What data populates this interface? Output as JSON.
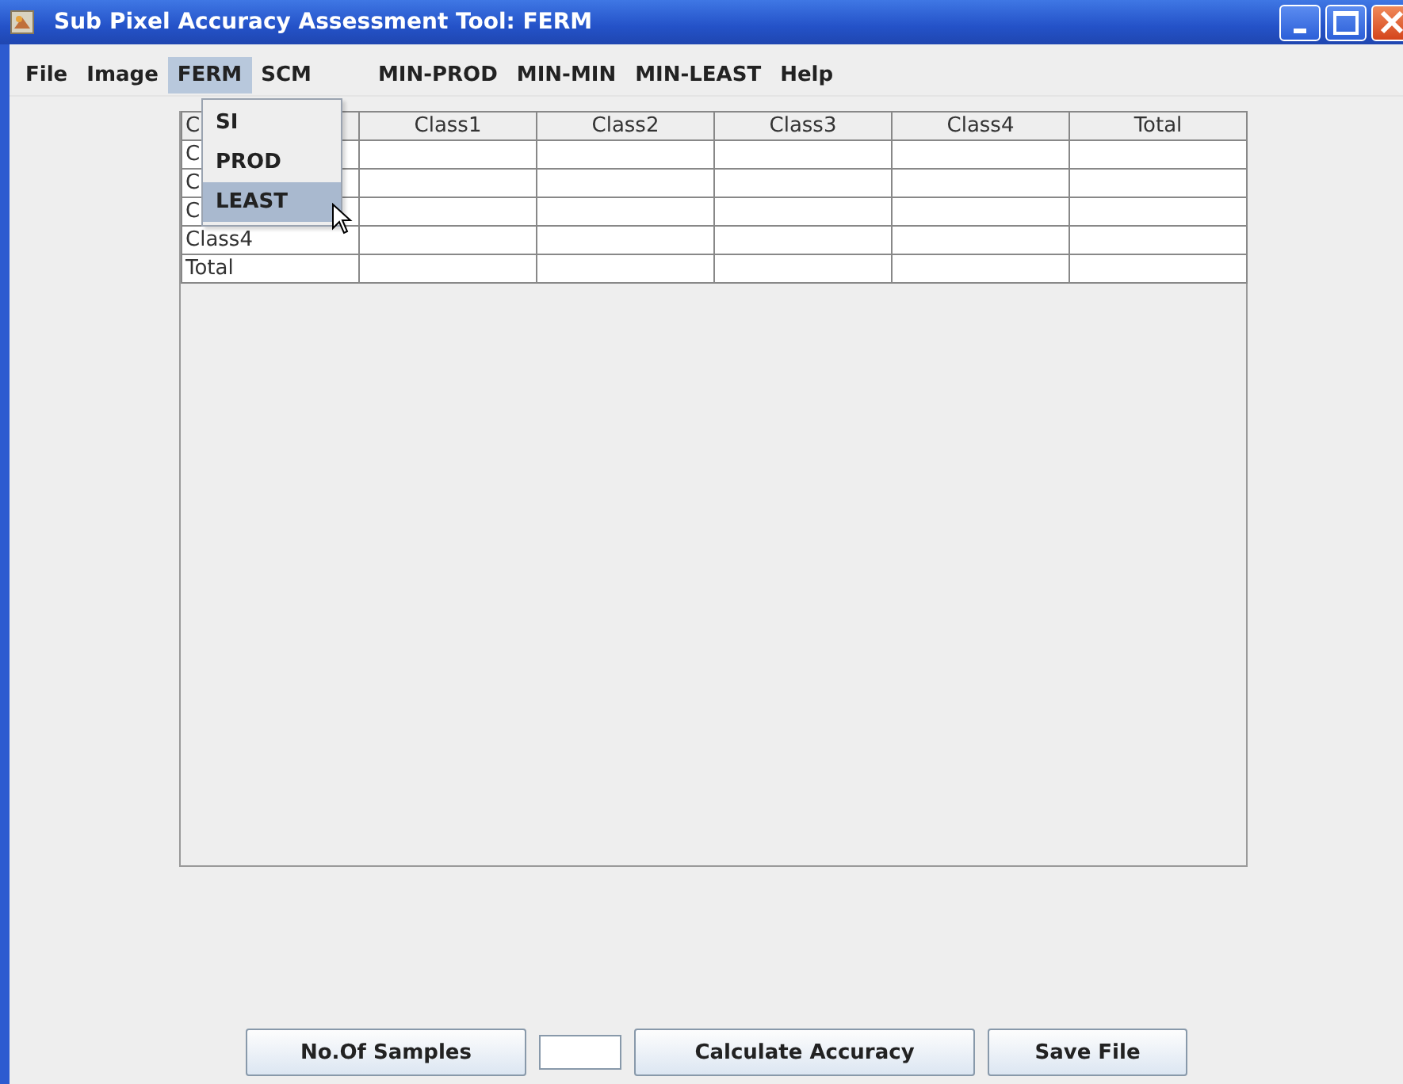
{
  "window": {
    "title": "Sub Pixel Accuracy Assessment Tool: FERM"
  },
  "menu_bar": [
    {
      "label": "File",
      "selected": false
    },
    {
      "label": "Image",
      "selected": false
    },
    {
      "label": "FERM",
      "selected": true
    },
    {
      "label": "SCM",
      "selected": false
    },
    {
      "label": "MIN-PROD",
      "selected": false
    },
    {
      "label": "MIN-MIN",
      "selected": false
    },
    {
      "label": "MIN-LEAST",
      "selected": false
    },
    {
      "label": "Help",
      "selected": false
    }
  ],
  "open_menu": {
    "items": [
      {
        "label": "SI",
        "selected": false
      },
      {
        "label": "PROD",
        "selected": false
      },
      {
        "label": "LEAST",
        "selected": true
      }
    ]
  },
  "table": {
    "columns": [
      "C",
      "Class1",
      "Class2",
      "Class3",
      "Class4",
      "Total"
    ],
    "rows": [
      [
        "C",
        null,
        null,
        null,
        null,
        null
      ],
      [
        "C",
        null,
        null,
        null,
        null,
        null
      ],
      [
        "C",
        null,
        null,
        null,
        null,
        null
      ],
      [
        "Class4",
        null,
        null,
        null,
        null,
        null
      ],
      [
        "Total",
        null,
        null,
        null,
        null,
        null
      ]
    ]
  },
  "bottom_bar": {
    "samples_button": "No.Of Samples",
    "calculate_button": "Calculate Accuracy",
    "save_button": "Save File"
  }
}
